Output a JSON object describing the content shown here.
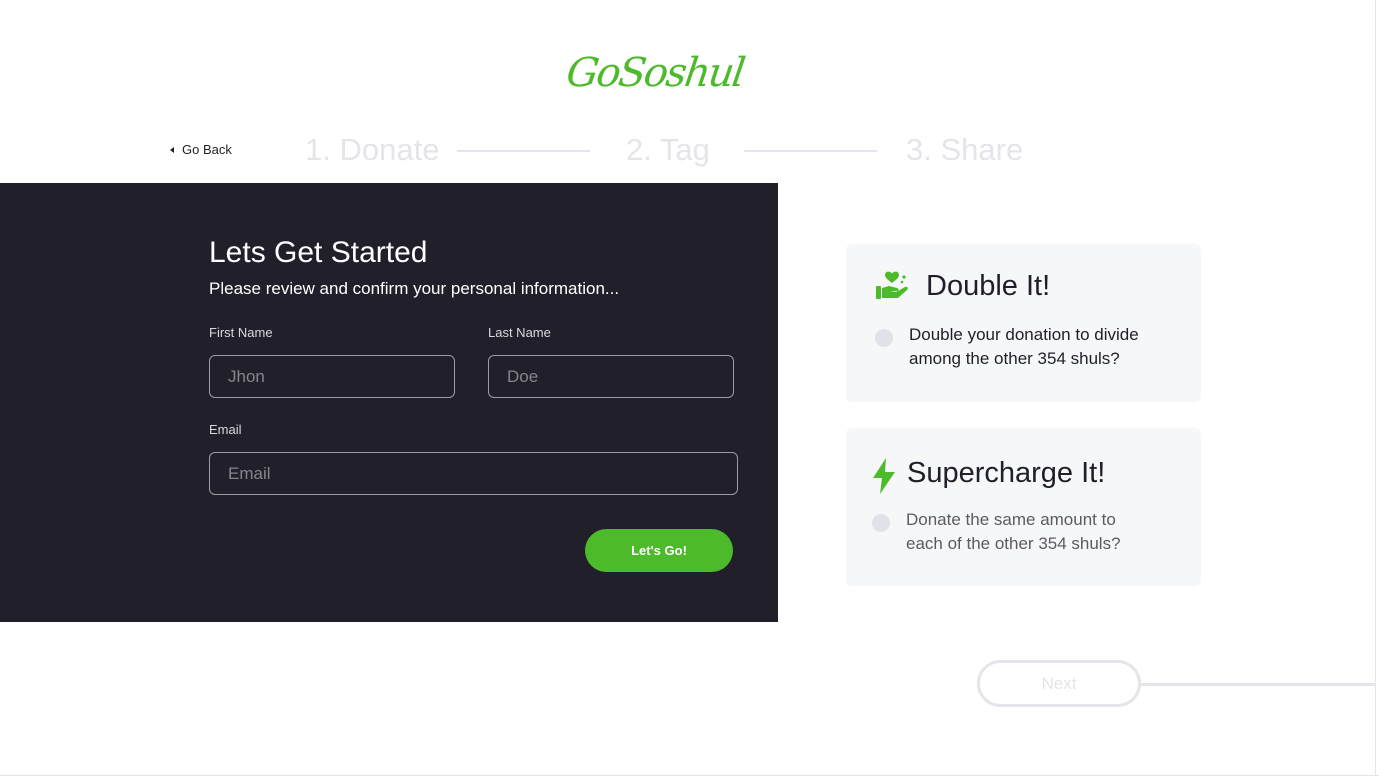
{
  "logo": {
    "text": "GoSoshul"
  },
  "nav": {
    "back_label": "Go Back"
  },
  "steps": [
    {
      "label": "1. Donate"
    },
    {
      "label": "2. Tag"
    },
    {
      "label": "3. Share"
    }
  ],
  "form": {
    "title": "Lets Get Started",
    "subtitle": "Please review and confirm your personal information...",
    "first_name": {
      "label": "First Name",
      "placeholder": "Jhon",
      "value": ""
    },
    "last_name": {
      "label": "Last Name",
      "placeholder": "Doe",
      "value": ""
    },
    "email": {
      "label": "Email",
      "placeholder": "Email",
      "value": ""
    },
    "submit_label": "Let's Go!"
  },
  "options": {
    "double": {
      "title": "Double It!",
      "text_line1": "Double your donation to divide",
      "text_line2": "among the other 354 shuls?",
      "selected": false,
      "icon": "hand-heart-icon"
    },
    "supercharge": {
      "title": "Supercharge It!",
      "text_line1": "Donate the same amount to",
      "text_line2": "each of the other 354 shuls?",
      "selected": false,
      "icon": "lightning-bolt-icon"
    }
  },
  "footer": {
    "next_label": "Next"
  },
  "colors": {
    "brand_green": "#4dba2c",
    "dark_panel": "#211f29",
    "muted_gray": "#e3e5ea",
    "card_bg": "#f6f7f9"
  }
}
